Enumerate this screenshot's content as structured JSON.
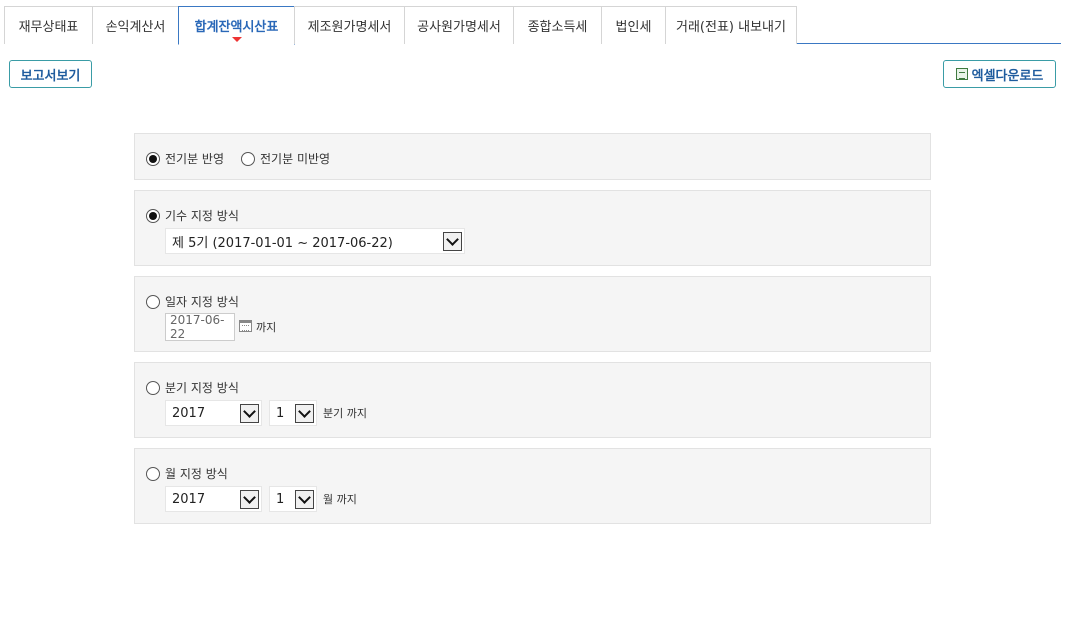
{
  "tabs": [
    {
      "label": "재무상태표"
    },
    {
      "label": "손익계산서"
    },
    {
      "label": "합계잔액시산표"
    },
    {
      "label": "제조원가명세서"
    },
    {
      "label": "공사원가명세서"
    },
    {
      "label": "종합소득세"
    },
    {
      "label": "법인세"
    },
    {
      "label": "거래(전표) 내보내기"
    }
  ],
  "active_tab": "합계잔액시산표",
  "toolbar": {
    "report_view_label": "보고서보기",
    "excel_download_label": "엑셀다운로드"
  },
  "prior_period": {
    "reflect_label": "전기분 반영",
    "not_reflect_label": "전기분 미반영",
    "selected": "reflect"
  },
  "fiscal_term": {
    "label": "기수 지정 방식",
    "selected": true,
    "value": "제 5기 (2017-01-01 ~ 2017-06-22)"
  },
  "date_mode": {
    "label": "일자 지정 방식",
    "selected": false,
    "date_placeholder": "2017-06-22",
    "suffix": "까지"
  },
  "quarter_mode": {
    "label": "분기 지정 방식",
    "selected": false,
    "year": "2017",
    "quarter": "1",
    "suffix": "분기 까지"
  },
  "month_mode": {
    "label": "월 지정 방식",
    "selected": false,
    "year": "2017",
    "month": "1",
    "suffix": "월 까지"
  },
  "colors": {
    "accent": "#3a78c3",
    "button_border": "#3a9ca6",
    "active_caret": "#ee3333",
    "panel_bg": "#f5f5f5"
  }
}
